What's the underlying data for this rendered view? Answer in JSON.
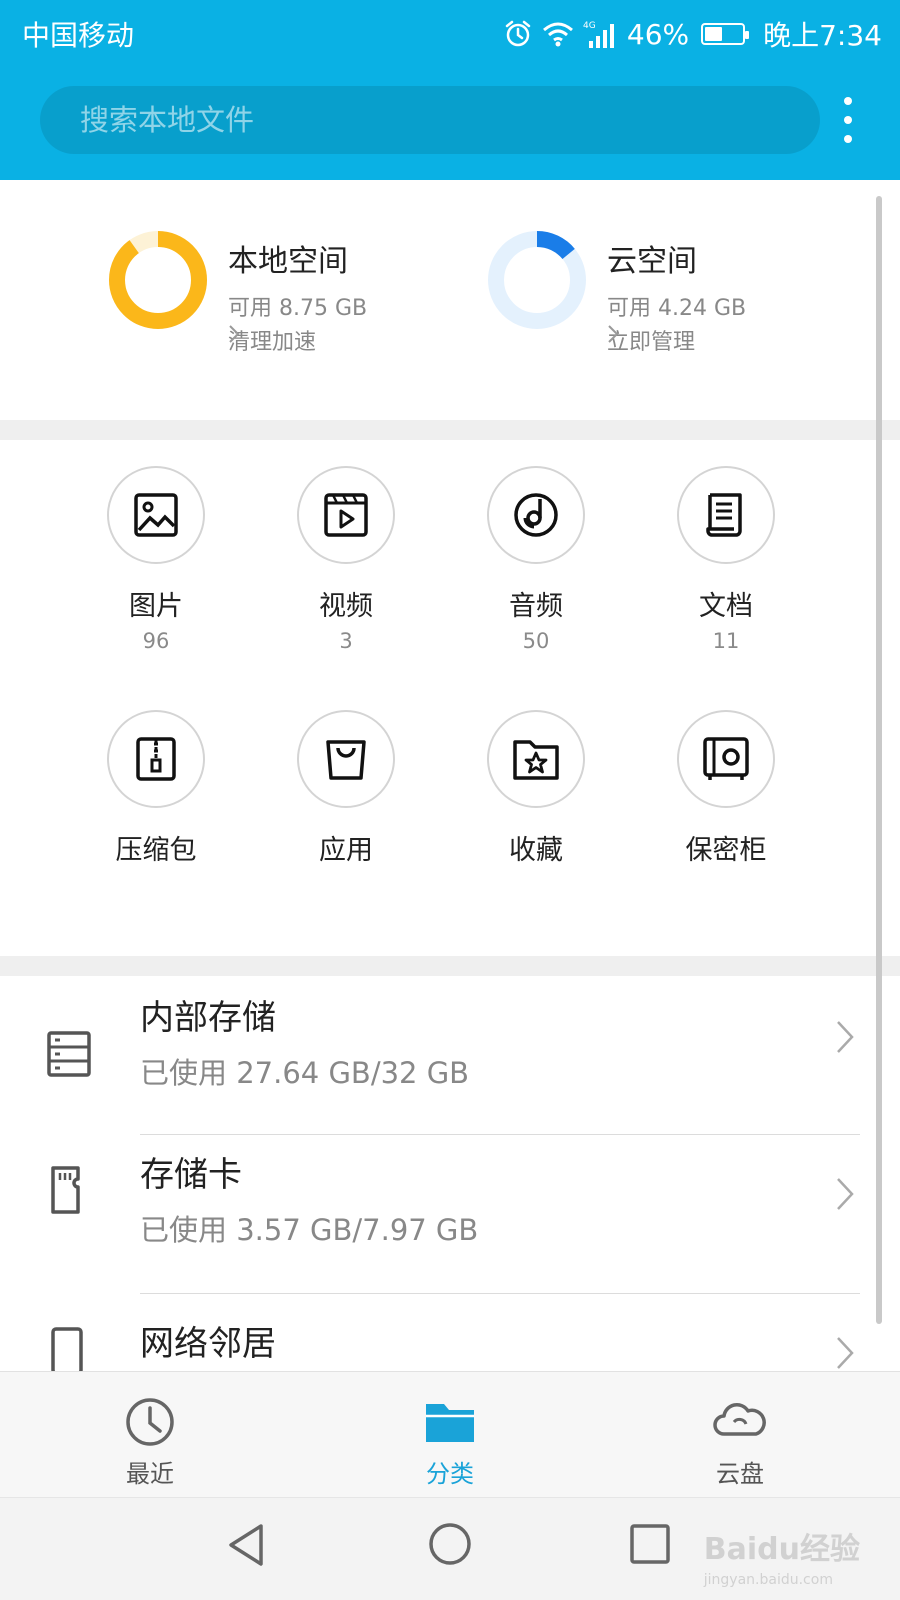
{
  "status_bar": {
    "carrier": "中国移动",
    "network": "4G",
    "battery_percent": "46%",
    "battery_level": 0.46,
    "time": "晚上7:34"
  },
  "search": {
    "placeholder": "搜索本地文件",
    "value": ""
  },
  "storage_summary": {
    "local": {
      "title": "本地空间",
      "available": "可用 8.75 GB",
      "action": "清理加速",
      "used_fraction": 0.9,
      "color": "#fbb71a",
      "track": "#fdf2d6"
    },
    "cloud": {
      "title": "云空间",
      "available": "可用 4.24 GB",
      "action": "立即管理",
      "used_fraction": 0.14,
      "color": "#1a7de8",
      "track": "#e4f1fd"
    }
  },
  "categories": [
    {
      "label": "图片",
      "count": "96",
      "icon": "image-icon"
    },
    {
      "label": "视频",
      "count": "3",
      "icon": "video-icon"
    },
    {
      "label": "音频",
      "count": "50",
      "icon": "audio-icon"
    },
    {
      "label": "文档",
      "count": "11",
      "icon": "document-icon"
    },
    {
      "label": "压缩包",
      "count": "",
      "icon": "archive-icon"
    },
    {
      "label": "应用",
      "count": "",
      "icon": "app-bag-icon"
    },
    {
      "label": "收藏",
      "count": "",
      "icon": "favorite-folder-icon"
    },
    {
      "label": "保密柜",
      "count": "",
      "icon": "safe-icon"
    }
  ],
  "storage_list": [
    {
      "name": "内部存储",
      "used": "已使用 27.64 GB/32 GB",
      "icon": "internal-storage-icon"
    },
    {
      "name": "存储卡",
      "used": "已使用 3.57 GB/7.97 GB",
      "icon": "sd-card-icon"
    },
    {
      "name": "网络邻居",
      "icon": "network-neighbor-icon"
    }
  ],
  "tabs": [
    {
      "label": "最近",
      "icon": "clock-icon",
      "active": false
    },
    {
      "label": "分类",
      "icon": "folder-icon",
      "active": true
    },
    {
      "label": "云盘",
      "icon": "cloud-icon",
      "active": false
    }
  ],
  "colors": {
    "header": "#0ab1e4",
    "accent": "#1aa3d8",
    "local_ring": "#fbb71a",
    "cloud_ring": "#1a7de8"
  },
  "watermark": {
    "text": "Baidu经验",
    "sub": "jingyan.baidu.com"
  }
}
